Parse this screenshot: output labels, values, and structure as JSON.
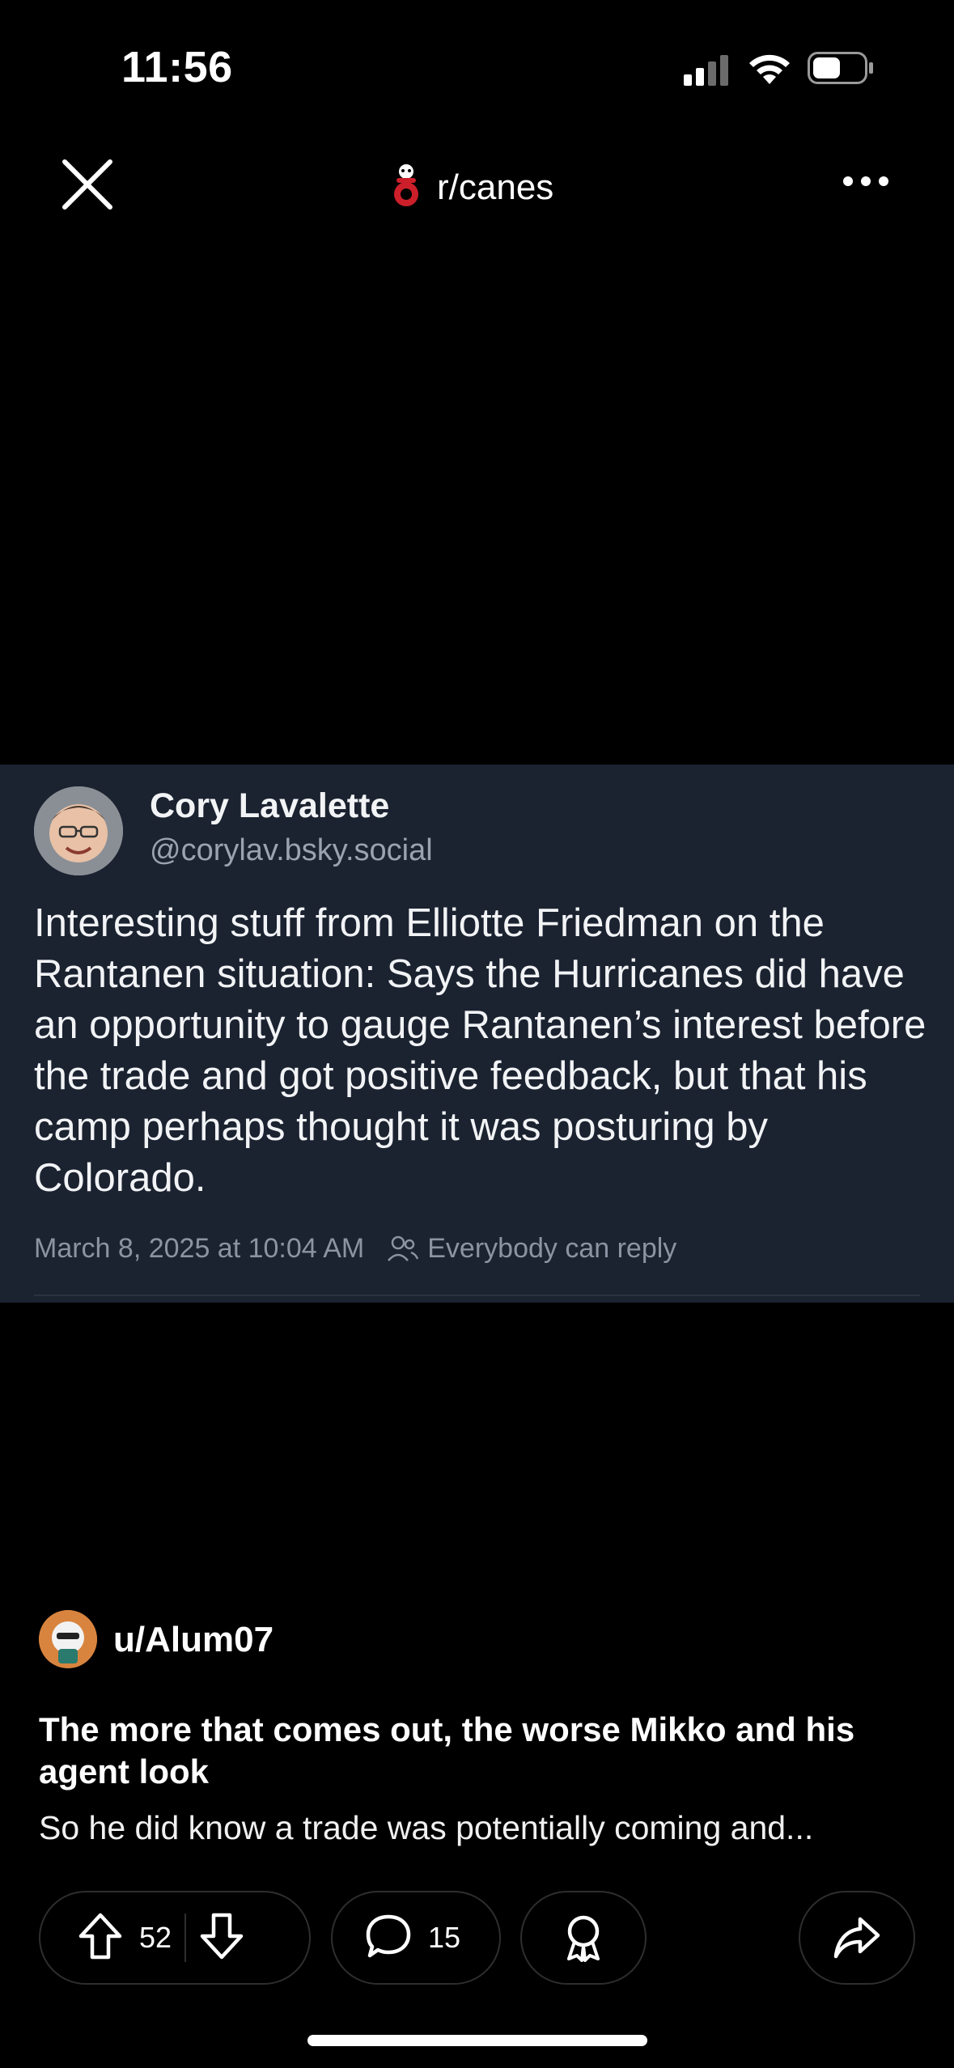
{
  "status_bar": {
    "time": "11:56",
    "battery_level": 0.55
  },
  "header": {
    "close_icon": "close-icon",
    "subreddit": "r/canes",
    "more_icon": "more-icon"
  },
  "embed": {
    "author_name": "Cory Lavalette",
    "author_handle": "@corylav.bsky.social",
    "text": "Interesting stuff from Elliotte Friedman on the Rantanen situation: Says the Hurricanes did have an opportunity to gauge Rantanen’s interest before the trade and got positive feedback, but that his camp perhaps thought it was posturing by Colorado.",
    "timestamp": "March 8, 2025 at 10:04 AM",
    "reply_setting": "Everybody can reply"
  },
  "post": {
    "username": "u/Alum07",
    "title": "The more that comes out, the worse Mikko and his agent look",
    "body_preview": "So he did know a trade was potentially coming and..."
  },
  "actions": {
    "upvotes": "52",
    "comments": "15"
  },
  "colors": {
    "background": "#000000",
    "embed_background": "#1b2230",
    "pill_border": "#2e2e2e"
  }
}
